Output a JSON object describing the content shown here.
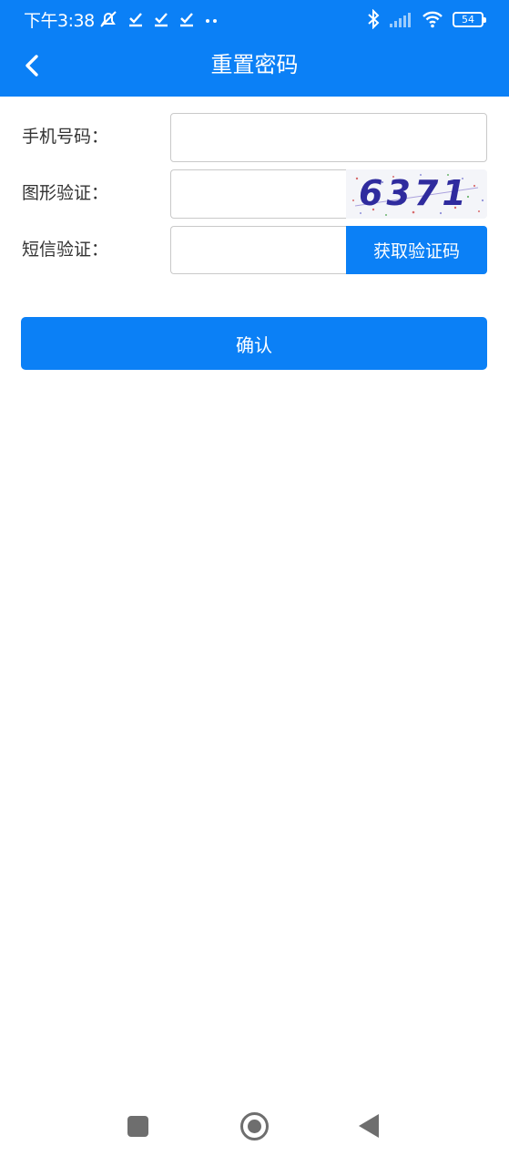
{
  "status_bar": {
    "time": "下午3:38",
    "battery_level": "54",
    "icons": [
      "alarm-off-icon",
      "check-icon",
      "check-icon",
      "check-icon",
      "more-dots-icon",
      "bluetooth-icon",
      "signal-icon",
      "wifi-icon",
      "battery-icon"
    ]
  },
  "header": {
    "title": "重置密码",
    "back_icon": "chevron-left-icon"
  },
  "form": {
    "phone_label": "手机号码：",
    "phone_value": "",
    "captcha_label": "图形验证：",
    "captcha_value": "",
    "captcha_image_text": "6371",
    "sms_label": "短信验证：",
    "sms_value": "",
    "sms_button": "获取验证码"
  },
  "confirm_button": "确认",
  "nav_bar": {
    "icons": [
      "recent-apps-icon",
      "home-icon",
      "back-triangle-icon"
    ]
  },
  "colors": {
    "primary": "#0b80f6",
    "captcha_text": "#2f2b9e",
    "nav_gray": "#6e6e6e"
  }
}
